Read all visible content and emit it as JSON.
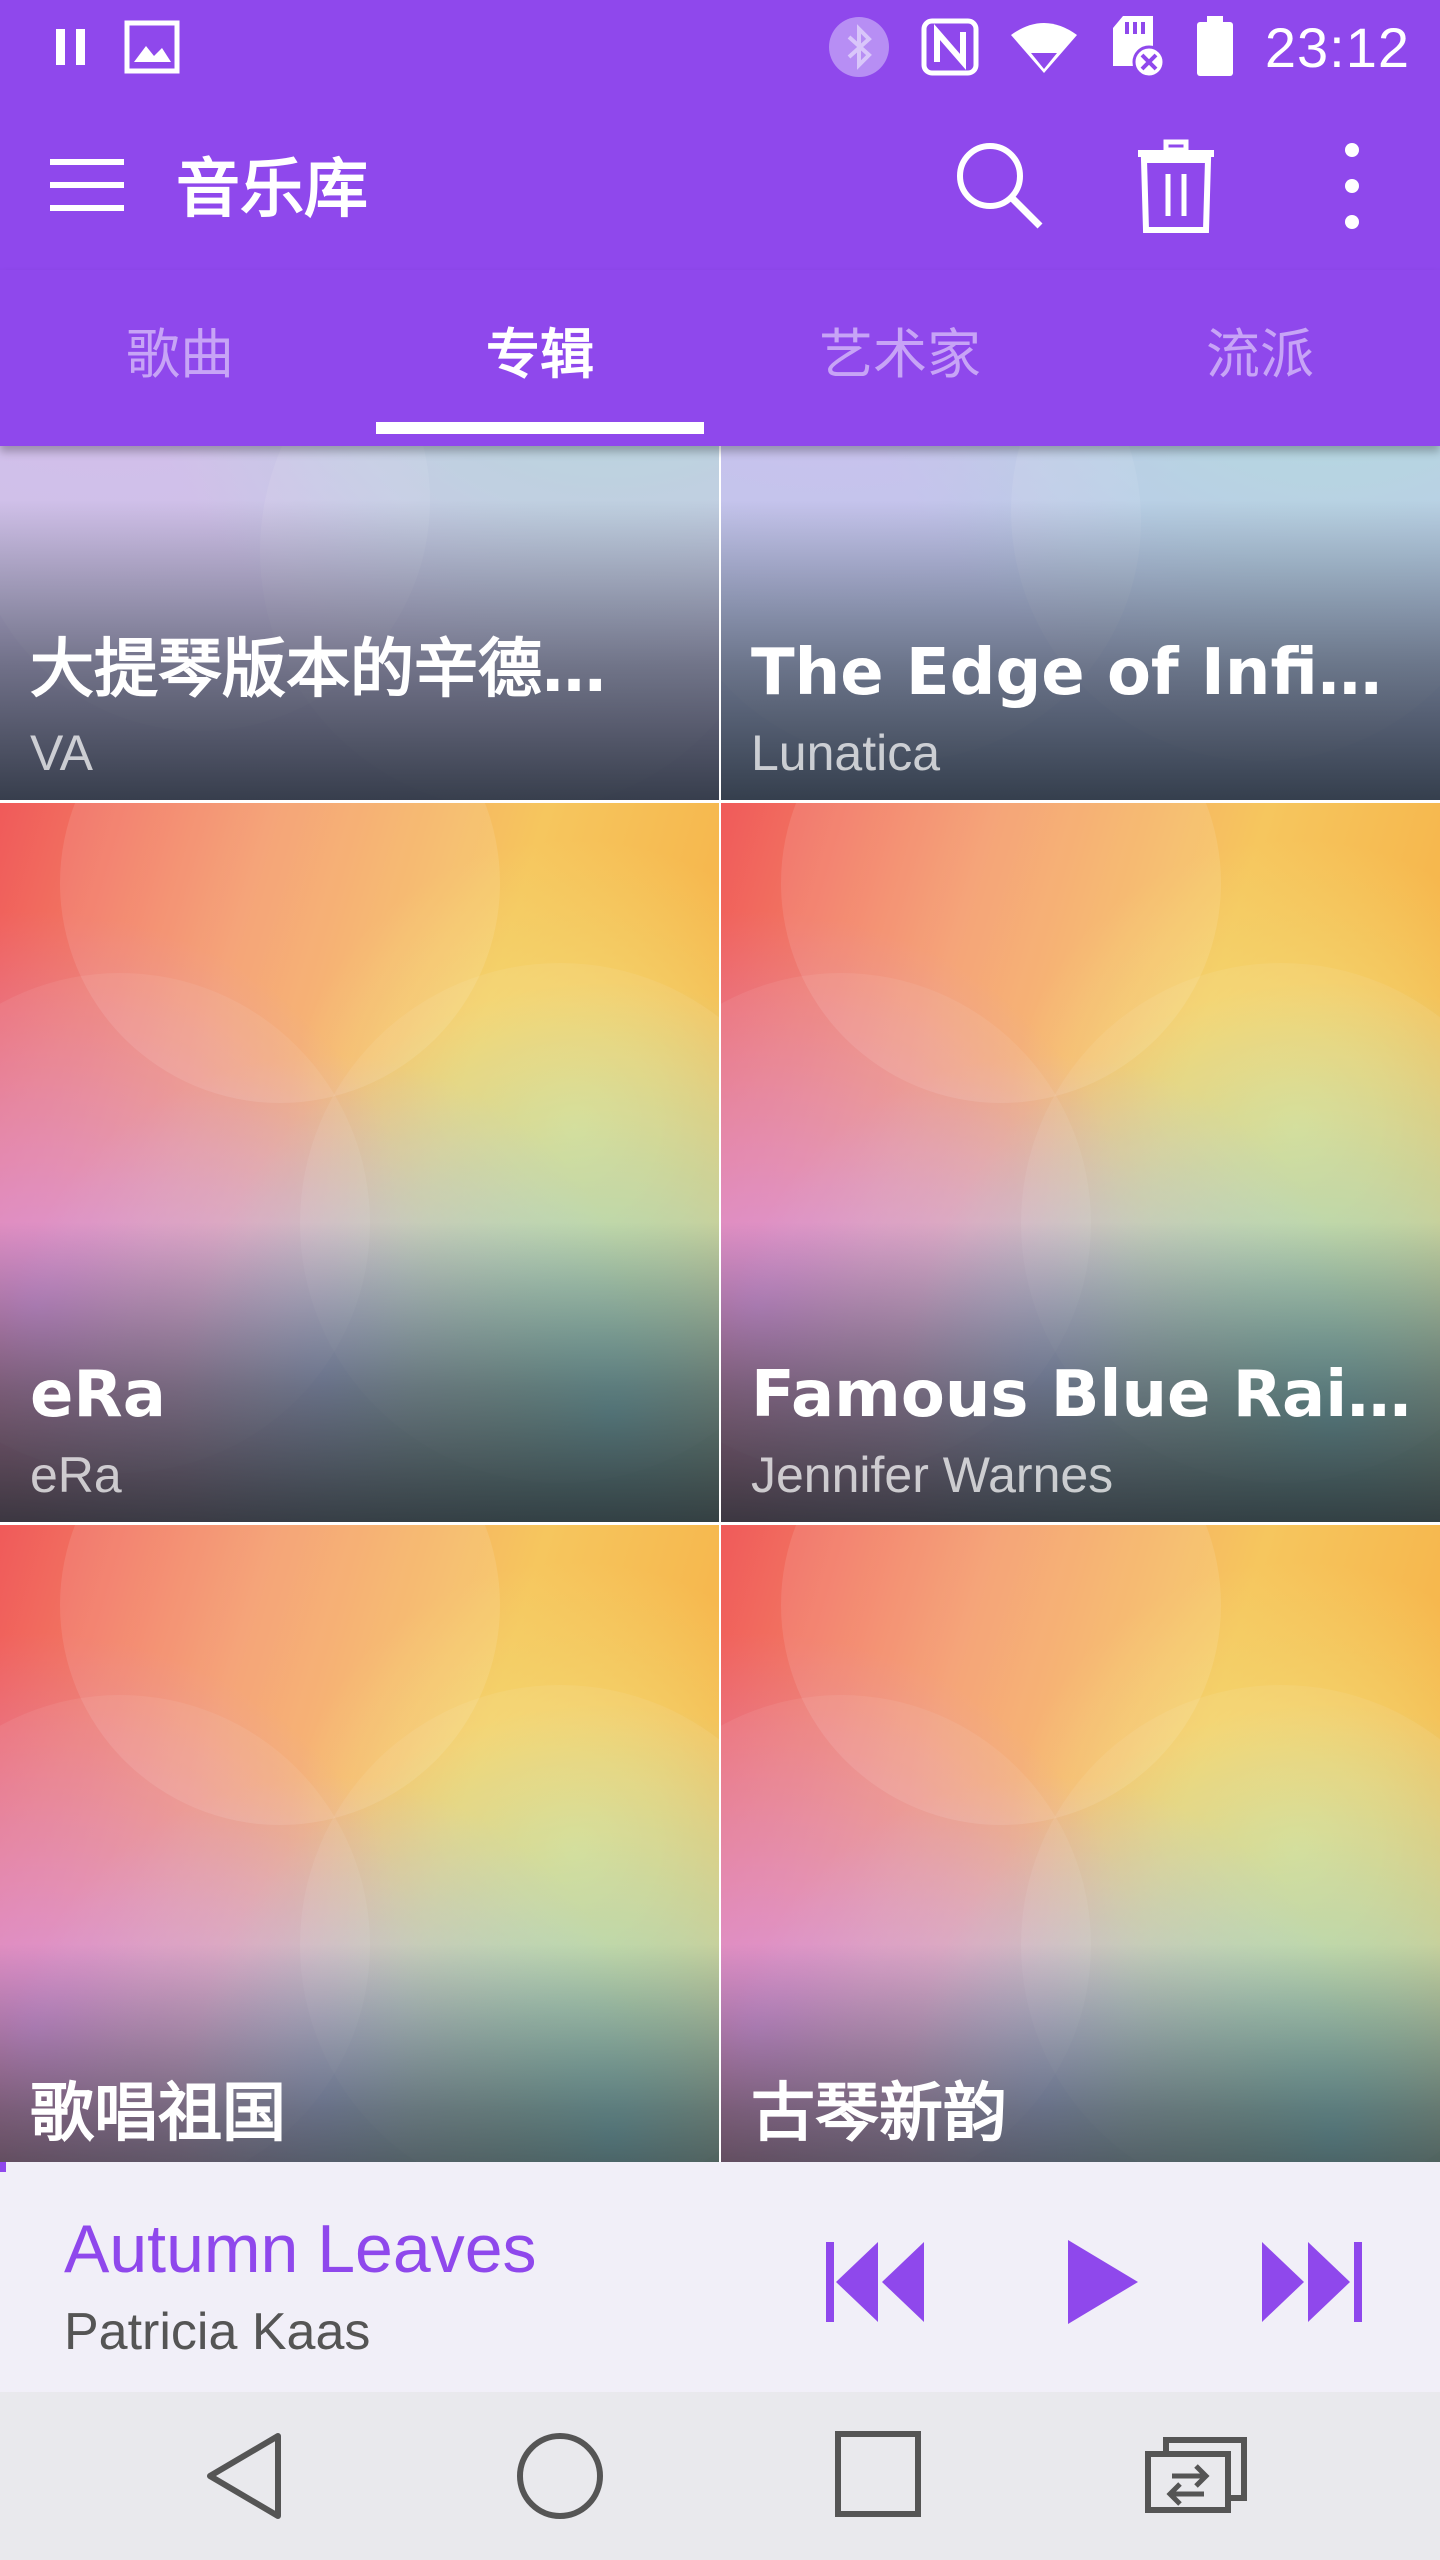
{
  "status_bar": {
    "time": "23:12",
    "left_icons": [
      "pause-icon",
      "image-icon"
    ],
    "right_icons": [
      "bluetooth-icon",
      "nfc-icon",
      "wifi-icon",
      "sd-card-icon",
      "battery-icon"
    ]
  },
  "app_bar": {
    "title": "音乐库",
    "actions": [
      "search-icon",
      "trash-icon",
      "more-vert-icon"
    ]
  },
  "tabs": [
    {
      "label": "歌曲",
      "active": false
    },
    {
      "label": "专辑",
      "active": true
    },
    {
      "label": "艺术家",
      "active": false
    },
    {
      "label": "流派",
      "active": false
    }
  ],
  "albums": [
    {
      "title": "大提琴版本的辛德…",
      "artist": "VA"
    },
    {
      "title": "The Edge of Infinity",
      "artist": "Lunatica"
    },
    {
      "title": "eRa",
      "artist": "eRa"
    },
    {
      "title": "Famous Blue Rain…",
      "artist": "Jennifer Warnes"
    },
    {
      "title": "歌唱祖国",
      "artist": ""
    },
    {
      "title": "古琴新韵",
      "artist": ""
    }
  ],
  "now_playing": {
    "title": "Autumn Leaves",
    "artist": "Patricia Kaas",
    "controls": [
      "previous-icon",
      "play-icon",
      "next-icon"
    ]
  },
  "nav_bar": [
    "back-icon",
    "home-icon",
    "recents-icon",
    "dual-window-icon"
  ],
  "colors": {
    "accent": "#8f48ec",
    "nowplaying_bg": "#f1eff8",
    "navbar_bg": "#e9e9ed"
  }
}
